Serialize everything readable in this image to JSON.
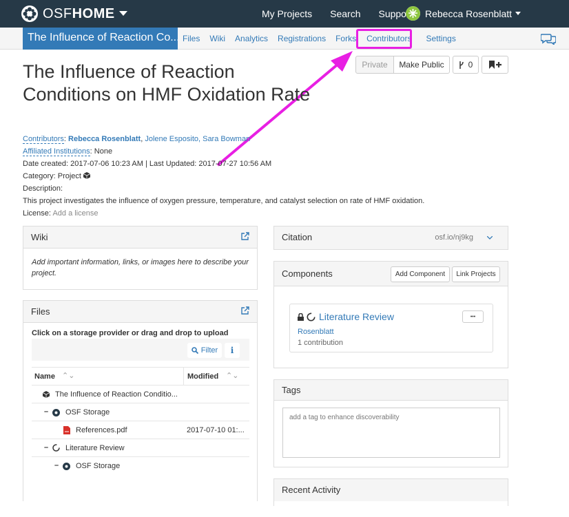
{
  "topbar": {
    "logo_prefix": "OSF",
    "logo_bold": "HOME",
    "nav": [
      "My Projects",
      "Search",
      "Support"
    ],
    "user_name": "Rebecca Rosenblatt"
  },
  "subnav": {
    "project_tab": "The Influence of Reaction Co...",
    "items": [
      "Files",
      "Wiki",
      "Analytics",
      "Registrations",
      "Forks",
      "Contributors",
      "Settings"
    ]
  },
  "project": {
    "title": "The Influence of Reaction Conditions on HMF Oxidation Rate",
    "contributors_label": "Contributors",
    "contributor_main": "Rebecca Rosenblatt",
    "contributors_rest": "Jolene Esposito, Sara Bowman",
    "affiliated_label": "Affiliated Institutions",
    "affiliated_value": "None",
    "dates": "Date created: 2017-07-06 10:23 AM | Last Updated: 2017-07-27 10:56 AM",
    "category": "Category: Project",
    "description_label": "Description:",
    "description": "This project investigates the influence of oxygen pressure, temperature, and catalyst selection on rate of HMF oxidation.",
    "license_label": "License:",
    "license_value": "Add a license"
  },
  "actions": {
    "private": "Private",
    "make_public": "Make Public",
    "fork_count": "0"
  },
  "wiki": {
    "title": "Wiki",
    "placeholder": "Add important information, links, or images here to describe your project."
  },
  "files": {
    "title": "Files",
    "instruction": "Click on a storage provider or drag and drop to upload",
    "filter": "Filter",
    "col_name": "Name",
    "col_modified": "Modified",
    "rows": [
      {
        "name": "The Influence of Reaction Conditio...",
        "modified": ""
      },
      {
        "name": "OSF Storage",
        "modified": ""
      },
      {
        "name": "References.pdf",
        "modified": "2017-07-10 01:..."
      },
      {
        "name": "Literature Review",
        "modified": ""
      },
      {
        "name": "OSF Storage",
        "modified": ""
      }
    ]
  },
  "citation": {
    "title": "Citation",
    "url": "osf.io/nj9kg"
  },
  "components": {
    "title": "Components",
    "add_component": "Add Component",
    "link_projects": "Link Projects",
    "item_title": "Literature Review",
    "item_author": "Rosenblatt",
    "item_contributions": "1 contribution",
    "menu": "•••"
  },
  "tags": {
    "title": "Tags",
    "placeholder": "add a tag to enhance discoverability"
  },
  "recent": {
    "title": "Recent Activity"
  },
  "colors": {
    "navbar": "#263947",
    "accent": "#337ab7",
    "annotation": "#e81fe3"
  }
}
